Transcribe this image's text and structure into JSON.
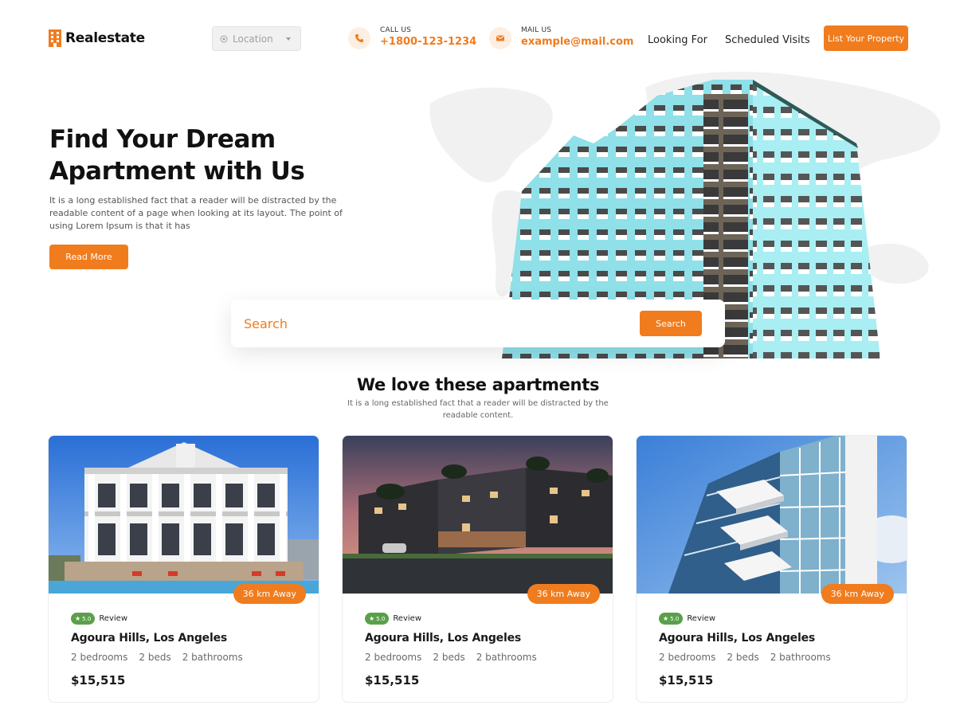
{
  "brand": {
    "name": "Realestate",
    "accent_color": "#f07c1e"
  },
  "header": {
    "location": {
      "placeholder": "Location",
      "icon": "location-pin-icon"
    },
    "call": {
      "label": "CALL US",
      "value": "+1800-123-1234",
      "icon": "phone-icon"
    },
    "mail": {
      "label": "MAIL US",
      "value": "example@mail.com",
      "icon": "mail-icon"
    },
    "nav": {
      "looking_for": "Looking For",
      "scheduled_visits": "Scheduled Visits"
    },
    "cta": "List Your Property"
  },
  "hero": {
    "title": "Find Your Dream Apartment with Us",
    "description": "It is a long established fact that a reader will be distracted by the readable content of a page when looking at its layout. The point of using Lorem Ipsum is that it has",
    "button": "Read More",
    "search": {
      "placeholder": "Search",
      "button": "Search"
    }
  },
  "section": {
    "title": "We love these apartments",
    "description": "It is a long established fact that a reader will be distracted by the readable content."
  },
  "listings": [
    {
      "distance": "36 km Away",
      "rating": "5.0",
      "review_label": "Review",
      "title": "Agoura Hills, Los Angeles",
      "bedrooms": "2 bedrooms",
      "beds": "2 beds",
      "bathrooms": "2 bathrooms",
      "price": "$15,515"
    },
    {
      "distance": "36 km Away",
      "rating": "5.0",
      "review_label": "Review",
      "title": "Agoura Hills, Los Angeles",
      "bedrooms": "2 bedrooms",
      "beds": "2 beds",
      "bathrooms": "2 bathrooms",
      "price": "$15,515"
    },
    {
      "distance": "36 km Away",
      "rating": "5.0",
      "review_label": "Review",
      "title": "Agoura Hills, Los Angeles",
      "bedrooms": "2 bedrooms",
      "beds": "2 beds",
      "bathrooms": "2 bathrooms",
      "price": "$15,515"
    }
  ]
}
